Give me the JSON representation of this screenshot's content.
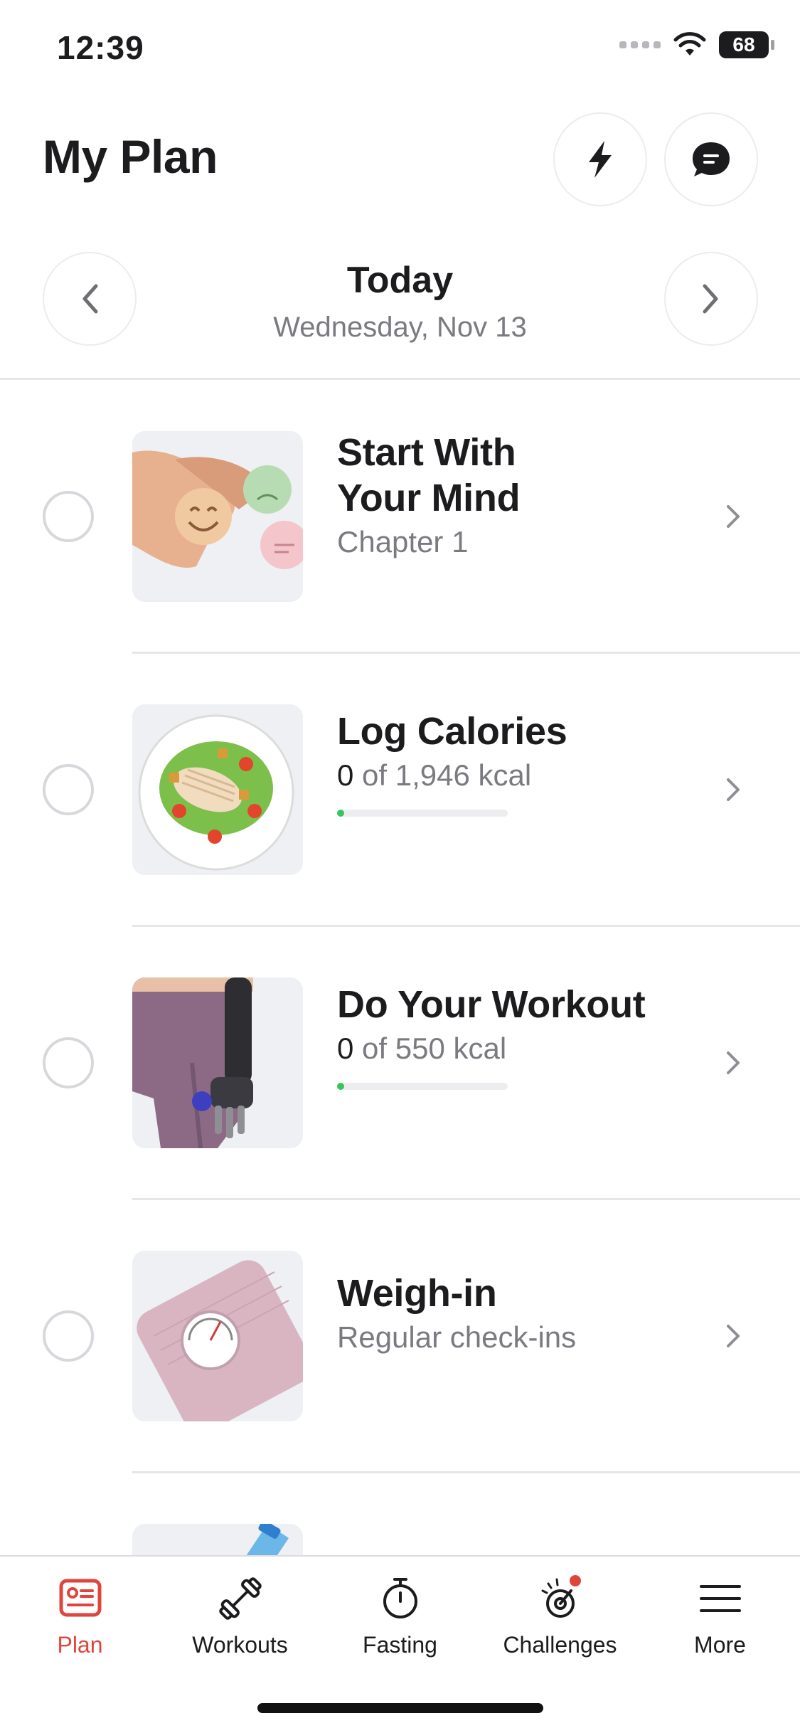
{
  "status_bar": {
    "time": "12:39",
    "battery": "68"
  },
  "header": {
    "title": "My Plan"
  },
  "date_nav": {
    "title": "Today",
    "subtitle": "Wednesday, Nov 13"
  },
  "plan": {
    "items": [
      {
        "title_line1": "Start With",
        "title_line2": "Your Mind",
        "subtitle": "Chapter 1"
      },
      {
        "title": "Log Calories",
        "value": "0",
        "rest": " of 1,946 kcal",
        "progress": 0
      },
      {
        "title": "Do Your Workout",
        "value": "0",
        "rest": " of 550 kcal",
        "progress": 0
      },
      {
        "title": "Weigh-in",
        "subtitle": "Regular check-ins"
      }
    ]
  },
  "tabs": [
    {
      "label": "Plan",
      "icon": "plan-icon",
      "active": true
    },
    {
      "label": "Workouts",
      "icon": "dumbbell-icon"
    },
    {
      "label": "Fasting",
      "icon": "stopwatch-icon"
    },
    {
      "label": "Challenges",
      "icon": "challenges-icon",
      "badge": true
    },
    {
      "label": "More",
      "icon": "menu-icon"
    }
  ],
  "colors": {
    "accent": "#e0453c",
    "progress": "#34c759"
  }
}
